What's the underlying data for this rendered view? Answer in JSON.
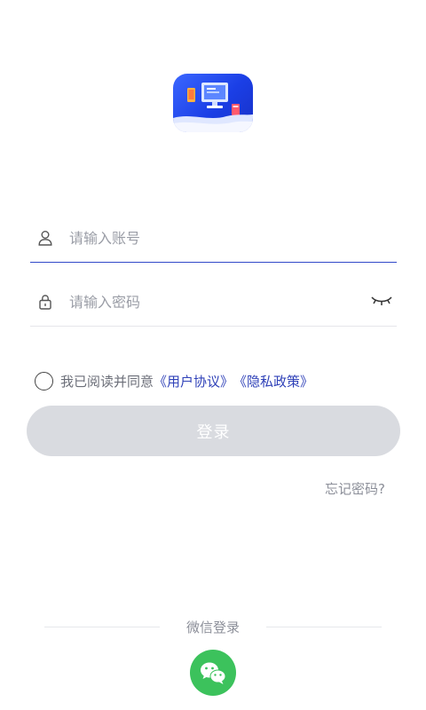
{
  "login": {
    "account_placeholder": "请输入账号",
    "password_placeholder": "请输入密码",
    "agreement_prefix": "我已阅读并同意",
    "user_agreement": "《用户协议》",
    "privacy_policy": "《隐私政策》",
    "login_button": "登录",
    "forgot_password": "忘记密码?",
    "wechat_login": "微信登录"
  },
  "icons": {
    "logo": "app-logo-icon",
    "account": "user-icon",
    "password": "lock-icon",
    "toggle": "eye-closed-icon",
    "wechat": "wechat-icon"
  },
  "colors": {
    "accent": "#2f41b8",
    "wechat": "#3cc25c",
    "button_disabled": "#d9dbe0"
  }
}
